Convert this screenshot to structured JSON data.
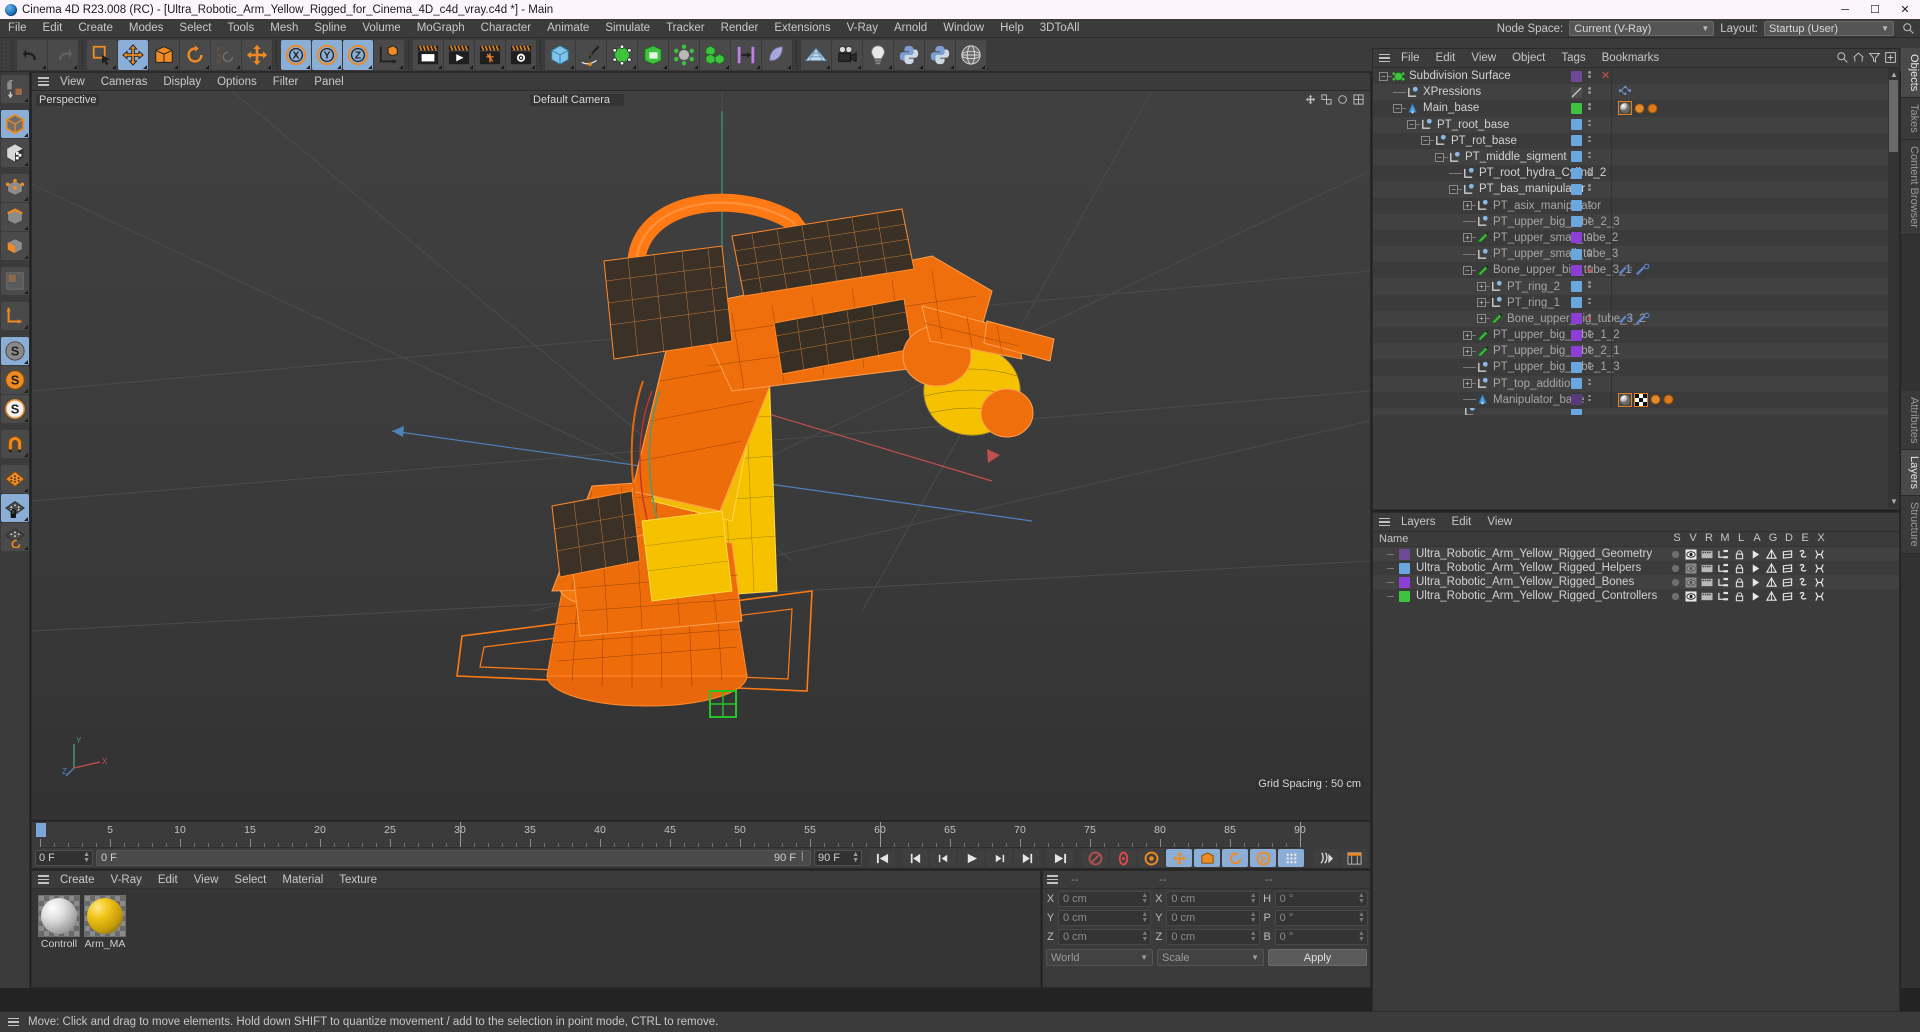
{
  "window": {
    "title": "Cinema 4D R23.008 (RC) - [Ultra_Robotic_Arm_Yellow_Rigged_for_Cinema_4D_c4d_vray.c4d *] - Main",
    "minimize": "─",
    "maximize": "☐",
    "close": "✕"
  },
  "menubar": {
    "items": [
      "File",
      "Edit",
      "Create",
      "Modes",
      "Select",
      "Tools",
      "Mesh",
      "Spline",
      "Volume",
      "MoGraph",
      "Character",
      "Animate",
      "Simulate",
      "Tracker",
      "Render",
      "Extensions",
      "V-Ray",
      "Arnold",
      "Window",
      "Help",
      "3DToAll"
    ],
    "node_space_label": "Node Space:",
    "node_space_value": "Current (V-Ray)",
    "layout_label": "Layout:",
    "layout_value": "Startup (User)",
    "search_icon": "search-icon"
  },
  "viewport": {
    "menu": [
      "View",
      "Cameras",
      "Display",
      "Options",
      "Filter",
      "Panel"
    ],
    "projection_label": "Perspective",
    "camera_label": "Default Camera",
    "grid_spacing": "Grid Spacing : 50 cm",
    "axis_labels": {
      "x": "X",
      "y": "Y",
      "z": "Z"
    }
  },
  "timeline": {
    "ticks": [
      0,
      5,
      10,
      15,
      20,
      25,
      30,
      35,
      40,
      45,
      50,
      55,
      60,
      65,
      70,
      75,
      80,
      85,
      90
    ],
    "current_frame": "0 F",
    "range_start": "0 F",
    "range_end": "90 F",
    "preview_end": "90 F",
    "doc_end": "90 F",
    "transport": [
      "go-to-start-icon",
      "previous-keyframe-icon",
      "step-back-icon",
      "play-icon",
      "step-forward-icon",
      "next-keyframe-icon",
      "go-to-end-icon"
    ],
    "record_buttons": [
      "record-active-objects-icon",
      "autokeying-icon",
      "keyframe-selection-icon",
      "position-key-icon",
      "scale-key-icon",
      "rotation-key-icon",
      "param-key-icon",
      "pla-key-icon"
    ],
    "extra_buttons": [
      "animation-mode-icon",
      "timeline-icon"
    ]
  },
  "material_manager": {
    "menu": [
      "Create",
      "V-Ray",
      "Edit",
      "View",
      "Select",
      "Material",
      "Texture"
    ],
    "materials": [
      {
        "name": "Controll",
        "full_name": "Controller",
        "thumb": "grey-sphere"
      },
      {
        "name": "Arm_MA",
        "full_name": "Arm_MAT",
        "thumb": "yellow-sphere"
      }
    ]
  },
  "coordinates": {
    "header": [
      "--",
      "--",
      "--"
    ],
    "rows": [
      {
        "pos_label": "X",
        "pos_value": "0 cm",
        "size_label": "X",
        "size_value": "0 cm",
        "rot_label": "H",
        "rot_value": "0 °"
      },
      {
        "pos_label": "Y",
        "pos_value": "0 cm",
        "size_label": "Y",
        "size_value": "0 cm",
        "rot_label": "P",
        "rot_value": "0 °"
      },
      {
        "pos_label": "Z",
        "pos_value": "0 cm",
        "size_label": "Z",
        "size_value": "0 cm",
        "rot_label": "B",
        "rot_value": "0 °"
      }
    ],
    "system": "World",
    "mode": "Scale",
    "apply": "Apply"
  },
  "object_manager": {
    "menu": [
      "File",
      "Edit",
      "View",
      "Object",
      "Tags",
      "Bookmarks"
    ],
    "header_icons": [
      "search-icon",
      "home-icon",
      "filter-icon",
      "add-icon"
    ],
    "items": [
      {
        "label": "Subdivision Surface",
        "depth": 0,
        "icon": "subdivision-surface-icon",
        "expander": "minus",
        "chip": "#6e4a96",
        "close": true
      },
      {
        "label": "XPressions",
        "depth": 1,
        "icon": "null-object-icon",
        "expander": "none",
        "chip": "#4e4e4e",
        "chip_style": "diagonal",
        "tags": [
          "xpresso-tag"
        ]
      },
      {
        "label": "Main_base",
        "depth": 1,
        "icon": "joint-object-icon",
        "expander": "minus",
        "chip": "#3fc23f",
        "tags": [
          "material-tag",
          "vray-tag",
          "vray-tag2"
        ]
      },
      {
        "label": "PT_root_base",
        "depth": 2,
        "icon": "null-object-icon",
        "expander": "minus",
        "chip": "#6aa7de"
      },
      {
        "label": "PT_rot_base",
        "depth": 3,
        "icon": "null-object-icon",
        "expander": "minus",
        "chip": "#6aa7de"
      },
      {
        "label": "PT_middle_sigment",
        "depth": 4,
        "icon": "null-object-icon",
        "expander": "minus",
        "chip": "#6aa7de"
      },
      {
        "label": "PT_root_hydra_Cylind_2",
        "depth": 5,
        "icon": "null-object-icon",
        "expander": "none",
        "chip": "#6aa7de"
      },
      {
        "label": "PT_bas_manipulator",
        "depth": 5,
        "icon": "null-object-icon",
        "expander": "minus",
        "chip": "#6aa7de"
      },
      {
        "label": "PT_asix_manipulator",
        "depth": 6,
        "icon": "null-object-icon",
        "expander": "plus",
        "chip": "#6aa7de"
      },
      {
        "label": "PT_upper_big_tube_2_3",
        "depth": 6,
        "icon": "null-object-icon",
        "expander": "none",
        "chip": "#6aa7de"
      },
      {
        "label": "PT_upper_small_tube_2",
        "depth": 6,
        "icon": "bone-object-icon",
        "expander": "plus",
        "chip": "#8c3fd4"
      },
      {
        "label": "PT_upper_small_tube_3",
        "depth": 6,
        "icon": "null-object-icon",
        "expander": "none",
        "chip": "#6aa7de"
      },
      {
        "label": "Bone_upper_big_tube_3_1",
        "depth": 6,
        "icon": "bone-object-icon",
        "expander": "minus",
        "chip": "#8c3fd4",
        "reddot": true,
        "tags": [
          "constraint-tag",
          "ik-tag"
        ]
      },
      {
        "label": "PT_ring_2",
        "depth": 7,
        "icon": "null-object-icon",
        "expander": "plus",
        "chip": "#6aa7de"
      },
      {
        "label": "PT_ring_1",
        "depth": 7,
        "icon": "null-object-icon",
        "expander": "plus",
        "chip": "#6aa7de"
      },
      {
        "label": "Bone_upper_big_tube_3_2",
        "depth": 7,
        "icon": "bone-object-icon",
        "expander": "plus",
        "chip": "#8c3fd4",
        "reddot": true,
        "tags": [
          "constraint-tag",
          "ik-tag"
        ]
      },
      {
        "label": "PT_upper_big_tube_1_2",
        "depth": 6,
        "icon": "bone-object-icon",
        "expander": "plus",
        "chip": "#8c3fd4"
      },
      {
        "label": "PT_upper_big_tube_2_1",
        "depth": 6,
        "icon": "bone-object-icon",
        "expander": "plus",
        "chip": "#8c3fd4"
      },
      {
        "label": "PT_upper_big_tube_1_3",
        "depth": 6,
        "icon": "null-object-icon",
        "expander": "none",
        "chip": "#6aa7de"
      },
      {
        "label": "PT_top_addition",
        "depth": 6,
        "icon": "null-object-icon",
        "expander": "plus",
        "chip": "#6aa7de"
      },
      {
        "label": "Manipulator_base",
        "depth": 6,
        "icon": "joint-object-icon",
        "expander": "none",
        "chip": "#5a3a7a",
        "tags": [
          "material-tag",
          "uv-tag",
          "vray-tag",
          "vray-tag2"
        ]
      }
    ]
  },
  "layer_manager": {
    "menu": [
      "Layers",
      "Edit",
      "View"
    ],
    "columns": [
      "S",
      "V",
      "R",
      "M",
      "L",
      "A",
      "G",
      "D",
      "E",
      "X"
    ],
    "name_column": "Name",
    "rows": [
      {
        "name": "Ultra_Robotic_Arm_Yellow_Rigged_Geometry",
        "color": "#6e4a96",
        "visible": true
      },
      {
        "name": "Ultra_Robotic_Arm_Yellow_Rigged_Helpers",
        "color": "#6aa7de",
        "visible": false
      },
      {
        "name": "Ultra_Robotic_Arm_Yellow_Rigged_Bones",
        "color": "#8c3fd4",
        "visible": false
      },
      {
        "name": "Ultra_Robotic_Arm_Yellow_Rigged_Controllers",
        "color": "#3fc23f",
        "visible": true
      }
    ]
  },
  "right_tabs_top": [
    "Objects",
    "Takes",
    "Content Browser"
  ],
  "right_tabs_bottom": [
    "Attributes",
    "Layers",
    "Structure"
  ],
  "statusbar": {
    "message": "Move: Click and drag to move elements. Hold down SHIFT to quantize movement / add to the selection in point mode, CTRL to remove."
  },
  "left_toolbar": [
    {
      "icon": "make-editable-icon",
      "active": false
    },
    {
      "icon": "model-mode-icon",
      "active": true
    },
    {
      "icon": "texture-mode-icon",
      "active": false
    },
    {
      "icon": "point-mode-icon",
      "active": false
    },
    {
      "icon": "edge-mode-icon",
      "active": false
    },
    {
      "icon": "polygon-mode-icon",
      "active": false
    },
    {
      "icon": "workplane-mode-icon",
      "active": false
    },
    {
      "icon": "axis-mode-icon",
      "active": false
    },
    {
      "icon": "enable-snap-icon",
      "active": true
    },
    {
      "icon": "snap-settings-icon",
      "active": false
    },
    {
      "icon": "quantize-icon",
      "active": false
    },
    {
      "icon": "magnet-icon",
      "active": false
    },
    {
      "icon": "workplane-icon",
      "active": false
    },
    {
      "icon": "lock-workplane-icon",
      "active": true
    },
    {
      "icon": "planar-workplane-icon",
      "active": false
    }
  ],
  "top_toolbar": {
    "groups": [
      {
        "buttons": [
          {
            "icon": "undo-icon",
            "active": false
          },
          {
            "icon": "redo-icon",
            "active": false,
            "disabled": true
          }
        ]
      },
      {
        "buttons": [
          {
            "icon": "live-selection-icon",
            "active": false
          },
          {
            "icon": "move-tool-icon",
            "active": true
          },
          {
            "icon": "scale-tool-icon",
            "active": false
          },
          {
            "icon": "rotate-tool-icon",
            "active": false
          },
          {
            "icon": "psr-reset-icon",
            "active": false,
            "disabled": true
          },
          {
            "icon": "move-alt-icon",
            "active": false
          }
        ]
      },
      {
        "buttons": [
          {
            "icon": "lock-x-axis-icon",
            "active": true
          },
          {
            "icon": "lock-y-axis-icon",
            "active": true
          },
          {
            "icon": "lock-z-axis-icon",
            "active": true
          },
          {
            "icon": "world-object-coord-icon",
            "active": false
          }
        ]
      },
      {
        "buttons": [
          {
            "icon": "render-view-icon",
            "active": false
          },
          {
            "icon": "render-to-picture-viewer-icon",
            "active": false
          },
          {
            "icon": "render-queue-icon",
            "active": false
          },
          {
            "icon": "render-settings-icon",
            "active": false
          }
        ]
      },
      {
        "buttons": [
          {
            "icon": "cube-primitive-icon",
            "active": false
          },
          {
            "icon": "spline-pen-icon",
            "active": false
          },
          {
            "icon": "generator-icon",
            "active": false
          },
          {
            "icon": "spline-generator-icon",
            "active": false
          },
          {
            "icon": "deformer-icon",
            "active": false
          },
          {
            "icon": "mograph-icon",
            "active": false
          },
          {
            "icon": "field-icon",
            "active": false
          },
          {
            "icon": "scene-object-icon",
            "active": false
          }
        ]
      },
      {
        "buttons": [
          {
            "icon": "floor-environment-icon",
            "active": false
          },
          {
            "icon": "camera-icon",
            "active": false
          },
          {
            "icon": "light-icon",
            "active": false
          },
          {
            "icon": "python-generator-icon",
            "active": false
          },
          {
            "icon": "python-tag-icon",
            "active": false
          },
          {
            "icon": "sculpt-globe-icon",
            "active": false
          }
        ]
      }
    ]
  }
}
